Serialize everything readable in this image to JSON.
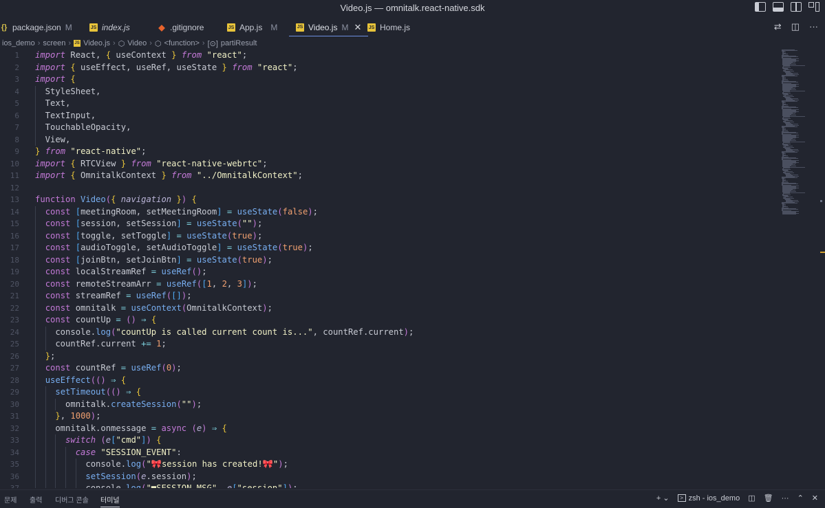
{
  "window": {
    "title": "Video.js — omnitalk.react-native.sdk"
  },
  "layout_icons": [
    "toggle-primary-sidebar-icon",
    "toggle-panel-icon",
    "toggle-secondary-sidebar-icon",
    "customize-layout-icon"
  ],
  "tabs": [
    {
      "name": "package.json",
      "status": "M",
      "icon": "json-icon",
      "italic": false
    },
    {
      "name": "index.js",
      "status": "",
      "icon": "js-icon",
      "italic": true
    },
    {
      "name": ".gitignore",
      "status": "",
      "icon": "git-icon",
      "italic": false
    },
    {
      "name": "App.js",
      "status": "M",
      "icon": "js-icon",
      "italic": false
    },
    {
      "name": "Video.js",
      "status": "M",
      "icon": "js-icon",
      "italic": false,
      "active": true,
      "close": "✕"
    },
    {
      "name": "Home.js",
      "status": "",
      "icon": "js-icon",
      "italic": false
    }
  ],
  "breadcrumb": [
    "ios_demo",
    "screen",
    "Video.js",
    "Video",
    "<function>",
    "partiResult"
  ],
  "line_numbers": [
    "1",
    "2",
    "3",
    "4",
    "5",
    "6",
    "7",
    "8",
    "9",
    "10",
    "11",
    "12",
    "13",
    "14",
    "15",
    "16",
    "17",
    "18",
    "19",
    "20",
    "21",
    "22",
    "23",
    "24",
    "25",
    "26",
    "27",
    "28",
    "29",
    "30",
    "31",
    "32",
    "33",
    "34",
    "35",
    "36",
    "37"
  ],
  "code_lines": [
    "import React, { useContext } from \"react\";",
    "import { useEffect, useRef, useState } from \"react\";",
    "import {",
    "  StyleSheet,",
    "  Text,",
    "  TextInput,",
    "  TouchableOpacity,",
    "  View,",
    "} from \"react-native\";",
    "import { RTCView } from \"react-native-webrtc\";",
    "import { OmnitalkContext } from \"../OmnitalkContext\";",
    "",
    "function Video({ navigation }) {",
    "  const [meetingRoom, setMeetingRoom] = useState(false);",
    "  const [session, setSession] = useState(\"\");",
    "  const [toggle, setToggle] = useState(true);",
    "  const [audioToggle, setAudioToggle] = useState(true);",
    "  const [joinBtn, setJoinBtn] = useState(true);",
    "  const localStreamRef = useRef();",
    "  const remoteStreamArr = useRef([1, 2, 3]);",
    "  const streamRef = useRef([]);",
    "  const omnitalk = useContext(OmnitalkContext);",
    "  const countUp = () => {",
    "    console.log(\"countUp is called current count is...\", countRef.current);",
    "    countRef.current += 1;",
    "  };",
    "  const countRef = useRef(0);",
    "  useEffect(() => {",
    "    setTimeout(() => {",
    "      omnitalk.createSession(\"\");",
    "    }, 1000);",
    "    omnitalk.onmessage = async (e) => {",
    "      switch (e[\"cmd\"]) {",
    "        case \"SESSION_EVENT\":",
    "          console.log(\"🎀session has created!🎀\");",
    "          setSession(e.session);",
    "          console.log(\"■SESSION_MSG\", e[\"session\"]);"
  ],
  "panel": {
    "tabs": [
      "문제",
      "출력",
      "디버그 콘솔",
      "터미널"
    ],
    "active_tab": "터미널",
    "terminal_name": "zsh - ios_demo"
  }
}
